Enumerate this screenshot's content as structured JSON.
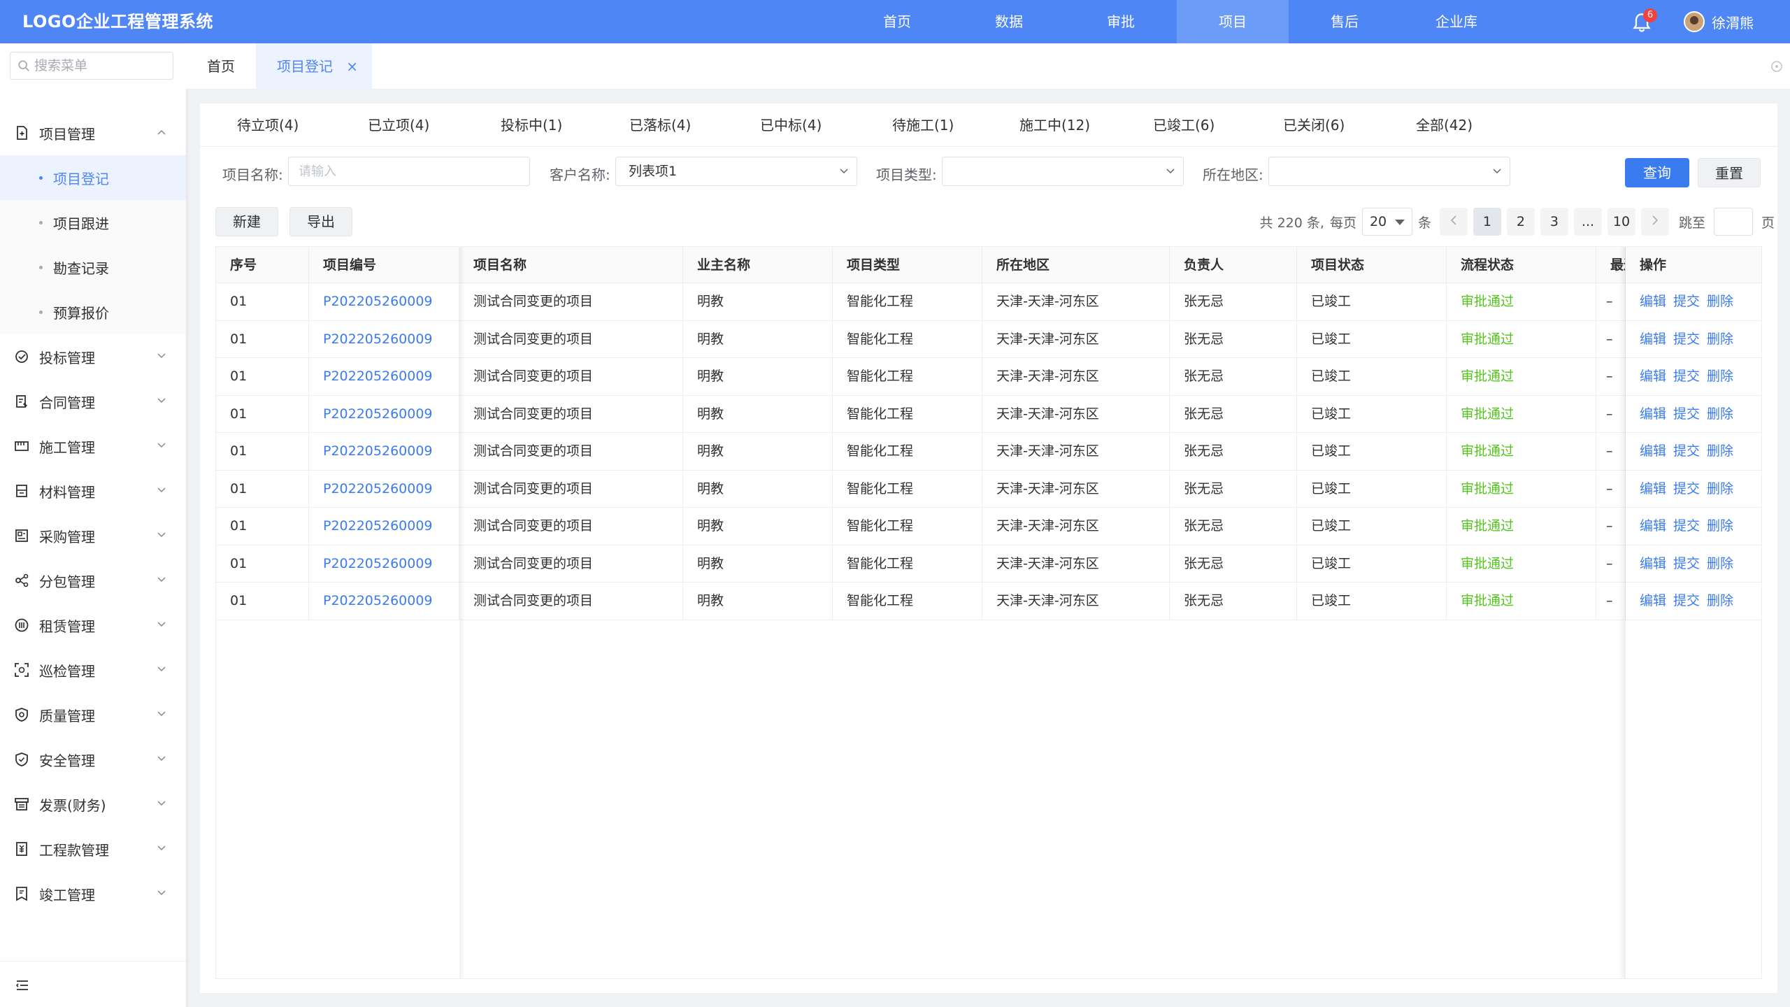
{
  "app": {
    "title": "LOGO企业工程管理系统",
    "user_name": "徐渭熊",
    "notification_count": "6",
    "accent": "#4f86f5"
  },
  "topnav": [
    {
      "label": "首页"
    },
    {
      "label": "数据"
    },
    {
      "label": "审批"
    },
    {
      "label": "项目",
      "active": true
    },
    {
      "label": "售后"
    },
    {
      "label": "企业库"
    }
  ],
  "sidebar": {
    "search_placeholder": "搜索菜单",
    "menu": [
      {
        "label": "项目管理",
        "icon": "project-icon",
        "expanded": true
      },
      {
        "label": "投标管理",
        "icon": "bid-icon"
      },
      {
        "label": "合同管理",
        "icon": "contract-icon"
      },
      {
        "label": "施工管理",
        "icon": "construction-icon"
      },
      {
        "label": "材料管理",
        "icon": "material-icon"
      },
      {
        "label": "采购管理",
        "icon": "purchase-icon"
      },
      {
        "label": "分包管理",
        "icon": "subcontract-icon"
      },
      {
        "label": "租赁管理",
        "icon": "lease-icon"
      },
      {
        "label": "巡检管理",
        "icon": "inspection-icon"
      },
      {
        "label": "质量管理",
        "icon": "quality-icon"
      },
      {
        "label": "安全管理",
        "icon": "safety-icon"
      },
      {
        "label": "发票(财务)",
        "icon": "invoice-icon"
      },
      {
        "label": "工程款管理",
        "icon": "payment-icon"
      },
      {
        "label": "竣工管理",
        "icon": "completion-icon"
      }
    ],
    "submenu": [
      {
        "label": "项目登记",
        "active": true
      },
      {
        "label": "项目跟进"
      },
      {
        "label": "勘查记录"
      },
      {
        "label": "预算报价"
      }
    ]
  },
  "page_tabs": {
    "home": "首页",
    "current": "项目登记",
    "close": "×"
  },
  "status_tabs": [
    "待立项(4)",
    "已立项(4)",
    "投标中(1)",
    "已落标(4)",
    "已中标(4)",
    "待施工(1)",
    "施工中(12)",
    "已竣工(6)",
    "已关闭(6)",
    "全部(42)"
  ],
  "filters": {
    "project_name_label": "项目名称:",
    "project_name_placeholder": "请输入",
    "customer_label": "客户名称:",
    "customer_value": "列表项1",
    "type_label": "项目类型:",
    "type_value": "",
    "region_label": "所在地区:",
    "region_value": "",
    "search_button": "查询",
    "reset_button": "重置"
  },
  "toolbar": {
    "new_button": "新建",
    "export_button": "导出"
  },
  "pagination": {
    "total_text": "共 220 条,",
    "per_page_label": "每页",
    "per_page_value": "20",
    "per_page_unit": "条",
    "pages": [
      "1",
      "2",
      "3",
      "...",
      "10"
    ],
    "current_page": "1",
    "jump_label": "跳至",
    "jump_unit": "页"
  },
  "table": {
    "headers": [
      "序号",
      "项目编号",
      "项目名称",
      "业主名称",
      "项目类型",
      "所在地区",
      "负责人",
      "项目状态",
      "流程状态",
      "最近",
      "操作"
    ],
    "rows": [
      {
        "no": "01",
        "code": "P202205260009",
        "name": "测试合同变更的项目",
        "owner": "明教",
        "type": "智能化工程",
        "region": "天津-天津-河东区",
        "leader": "张无忌",
        "status": "已竣工",
        "flow": "审批通过",
        "recent": "–"
      },
      {
        "no": "01",
        "code": "P202205260009",
        "name": "测试合同变更的项目",
        "owner": "明教",
        "type": "智能化工程",
        "region": "天津-天津-河东区",
        "leader": "张无忌",
        "status": "已竣工",
        "flow": "审批通过",
        "recent": "–"
      },
      {
        "no": "01",
        "code": "P202205260009",
        "name": "测试合同变更的项目",
        "owner": "明教",
        "type": "智能化工程",
        "region": "天津-天津-河东区",
        "leader": "张无忌",
        "status": "已竣工",
        "flow": "审批通过",
        "recent": "–"
      },
      {
        "no": "01",
        "code": "P202205260009",
        "name": "测试合同变更的项目",
        "owner": "明教",
        "type": "智能化工程",
        "region": "天津-天津-河东区",
        "leader": "张无忌",
        "status": "已竣工",
        "flow": "审批通过",
        "recent": "–"
      },
      {
        "no": "01",
        "code": "P202205260009",
        "name": "测试合同变更的项目",
        "owner": "明教",
        "type": "智能化工程",
        "region": "天津-天津-河东区",
        "leader": "张无忌",
        "status": "已竣工",
        "flow": "审批通过",
        "recent": "–"
      },
      {
        "no": "01",
        "code": "P202205260009",
        "name": "测试合同变更的项目",
        "owner": "明教",
        "type": "智能化工程",
        "region": "天津-天津-河东区",
        "leader": "张无忌",
        "status": "已竣工",
        "flow": "审批通过",
        "recent": "–"
      },
      {
        "no": "01",
        "code": "P202205260009",
        "name": "测试合同变更的项目",
        "owner": "明教",
        "type": "智能化工程",
        "region": "天津-天津-河东区",
        "leader": "张无忌",
        "status": "已竣工",
        "flow": "审批通过",
        "recent": "–"
      },
      {
        "no": "01",
        "code": "P202205260009",
        "name": "测试合同变更的项目",
        "owner": "明教",
        "type": "智能化工程",
        "region": "天津-天津-河东区",
        "leader": "张无忌",
        "status": "已竣工",
        "flow": "审批通过",
        "recent": "–"
      },
      {
        "no": "01",
        "code": "P202205260009",
        "name": "测试合同变更的项目",
        "owner": "明教",
        "type": "智能化工程",
        "region": "天津-天津-河东区",
        "leader": "张无忌",
        "status": "已竣工",
        "flow": "审批通过",
        "recent": "–"
      }
    ],
    "actions": [
      "编辑",
      "提交",
      "删除"
    ],
    "status_ok_color": "#52c41a",
    "link_color": "#3b7bf0"
  }
}
